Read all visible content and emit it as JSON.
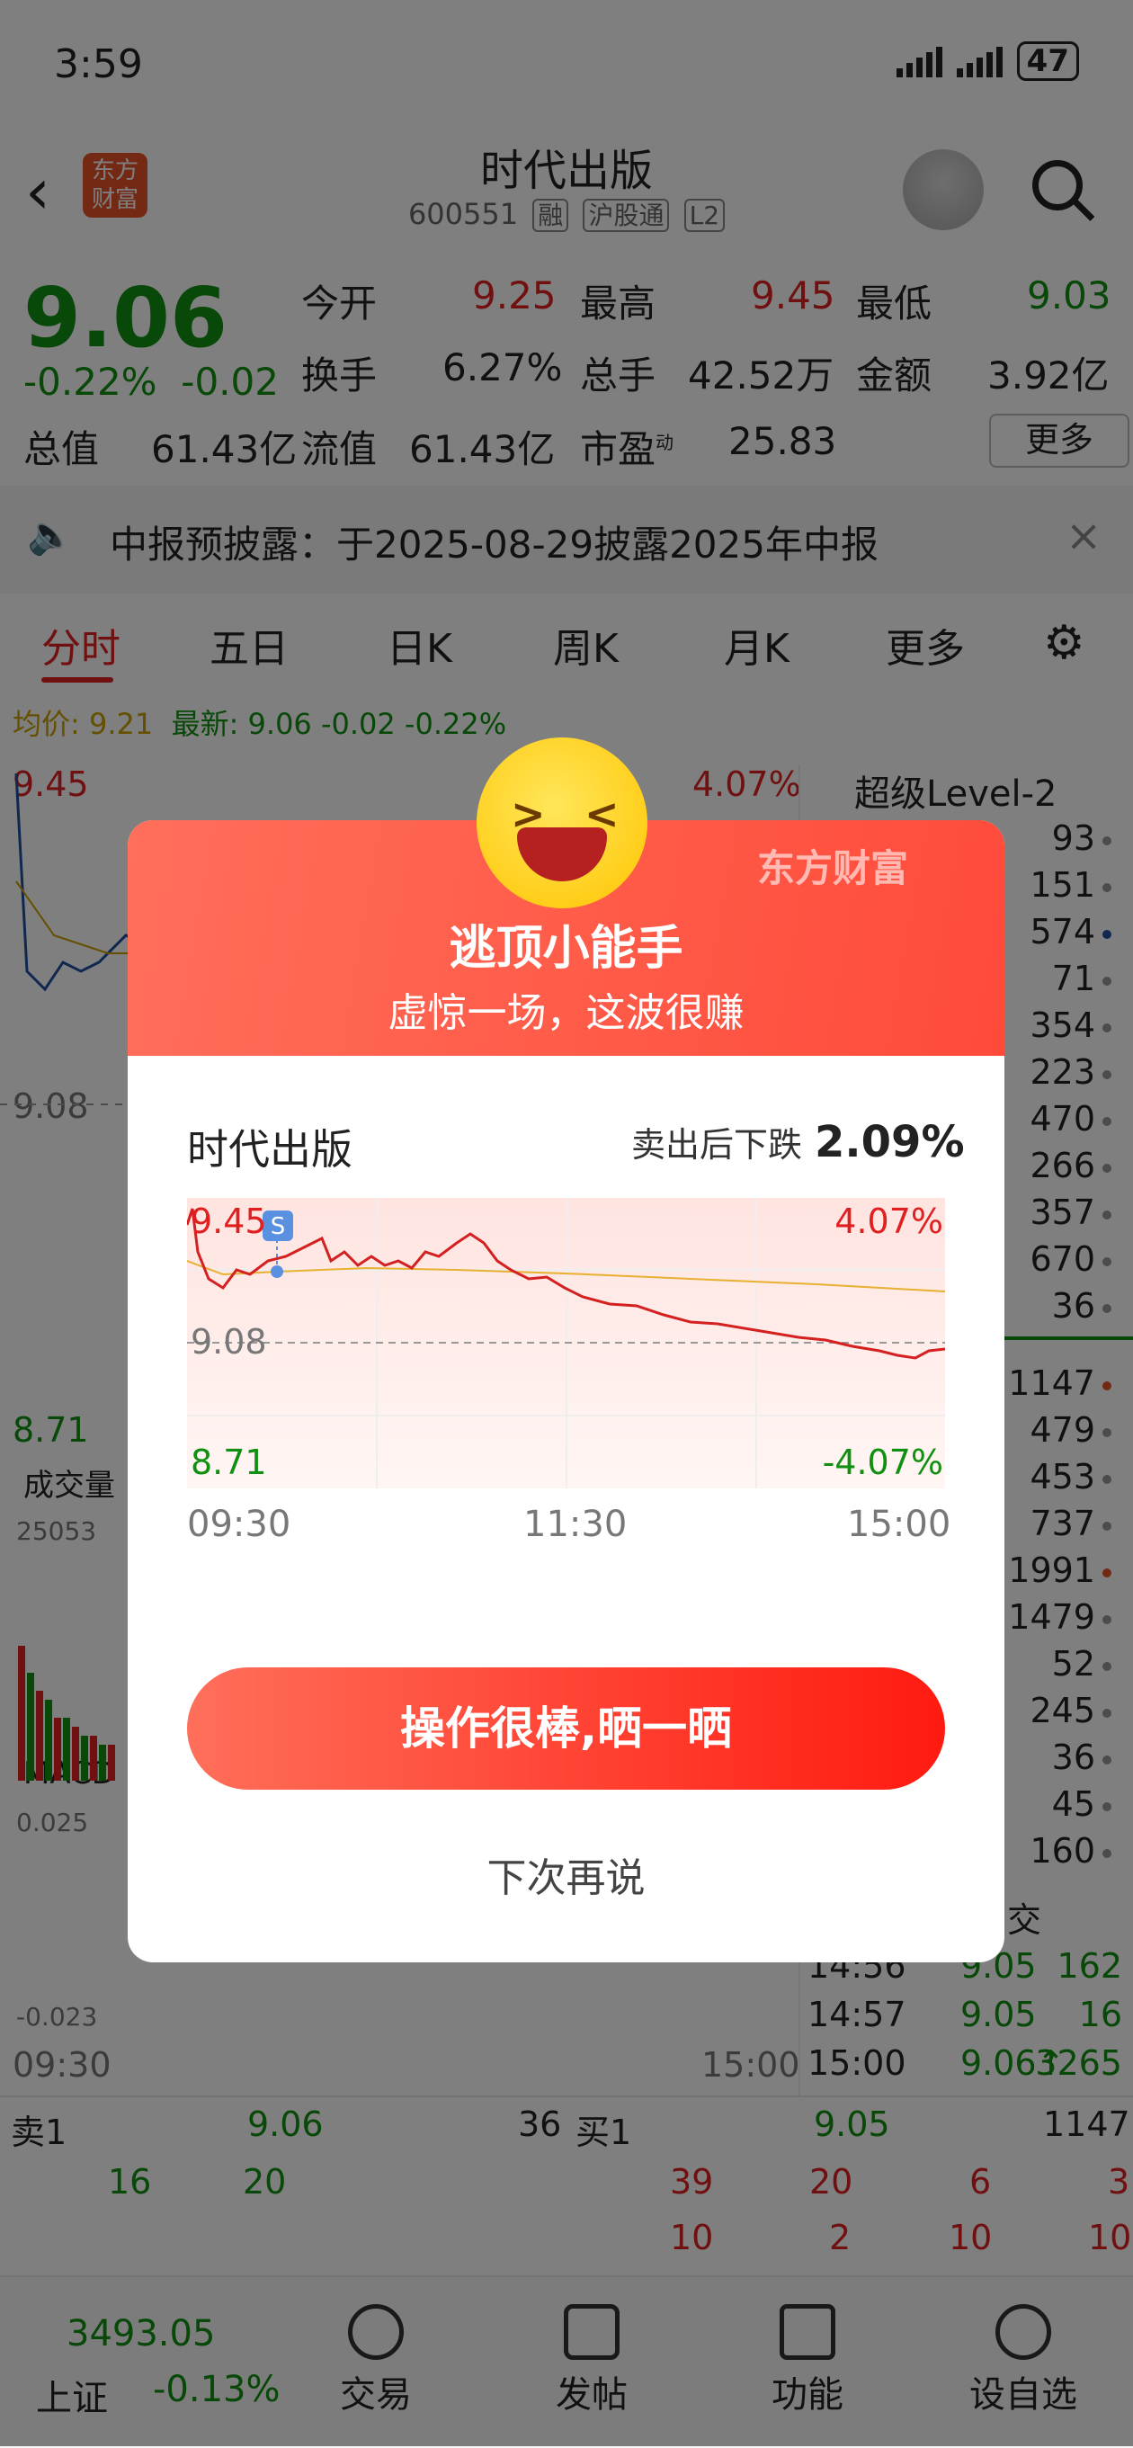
{
  "status": {
    "time": "3:59",
    "battery": "47"
  },
  "header": {
    "logo": "东方\n财富",
    "title": "时代出版",
    "code": "600551",
    "tags": [
      "融",
      "沪股通",
      "L2"
    ]
  },
  "quote": {
    "price": "9.06",
    "change_pct": "-0.22%",
    "change": "-0.02",
    "open_label": "今开",
    "open": "9.25",
    "high_label": "最高",
    "high": "9.45",
    "low_label": "最低",
    "low": "9.03",
    "turnover_label": "换手",
    "turnover": "6.27%",
    "volume_label": "总手",
    "volume": "42.52万",
    "amount_label": "金额",
    "amount": "3.92亿",
    "mktcap_label": "总值",
    "mktcap": "61.43亿",
    "float_label": "流值",
    "float": "61.43亿",
    "pe_label": "市盈",
    "pe_sup": "动",
    "pe": "25.83",
    "more": "更多"
  },
  "notice": {
    "text": "中报预披露：于2025-08-29披露2025年中报"
  },
  "tabs": [
    "分时",
    "五日",
    "日K",
    "周K",
    "月K",
    "更多"
  ],
  "chartinfo": {
    "avg_label": "均价:",
    "avg": "9.21",
    "latest_label": "最新:",
    "latest": "9.06",
    "chg": "-0.02",
    "pct": "-0.22%"
  },
  "bg_chart": {
    "top": "9.45",
    "top_pct": "4.07%",
    "mid": "9.08",
    "low": "8.71",
    "vol_label": "成交量",
    "vol_max": "25053",
    "macd_label": "MACD",
    "macd_top": "0.025",
    "macd_bottom": "-0.023",
    "t_start": "09:30",
    "t_end": "15:00"
  },
  "level2": {
    "title": "超级Level-2",
    "sell_vols": [
      "93",
      "151",
      "574",
      "71",
      "354",
      "223",
      "470",
      "266",
      "357",
      "670",
      "36"
    ],
    "buy_vols": [
      "1147",
      "479",
      "453",
      "737",
      "1991",
      "1479",
      "52",
      "245",
      "36",
      "45",
      "160"
    ],
    "ticks_label": "交",
    "ticks": [
      {
        "time": "14:56",
        "price": "9.05",
        "vol": "162"
      },
      {
        "time": "14:57",
        "price": "9.05",
        "vol": "16"
      },
      {
        "time": "15:00",
        "price": "9.06↑",
        "vol": "3265"
      }
    ]
  },
  "orderbook": {
    "sell_label": "卖1",
    "sell_price": "9.06",
    "sell_vol": "36",
    "buy_label": "买1",
    "buy_price": "9.05",
    "buy_vol": "1147",
    "row2_left": [
      "16",
      "20"
    ],
    "row2_right": [
      "39",
      "20",
      "6",
      "3"
    ],
    "row3_right": [
      "10",
      "2",
      "10",
      "10"
    ]
  },
  "nav": {
    "index_value": "3493.05",
    "index_name": "上证",
    "index_pct": "-0.13%",
    "items": [
      "交易",
      "发帖",
      "功能",
      "设自选"
    ]
  },
  "modal": {
    "brand": "东方财富",
    "title": "逃顶小能手",
    "subtitle": "虚惊一场，这波很赚",
    "stock": "时代出版",
    "drop_label": "卖出后下跌",
    "drop_value": "2.09%",
    "chart": {
      "top": "9.45",
      "top_pct": "4.07%",
      "mid": "9.08",
      "low": "8.71",
      "low_pct": "-4.07%",
      "sell_marker": "S",
      "times": [
        "09:30",
        "11:30",
        "15:00"
      ]
    },
    "share_button": "操作很棒,晒一晒",
    "later": "下次再说"
  },
  "colors": {
    "up": "#e02020",
    "down": "#109010",
    "accent": "#ff4a3a"
  }
}
